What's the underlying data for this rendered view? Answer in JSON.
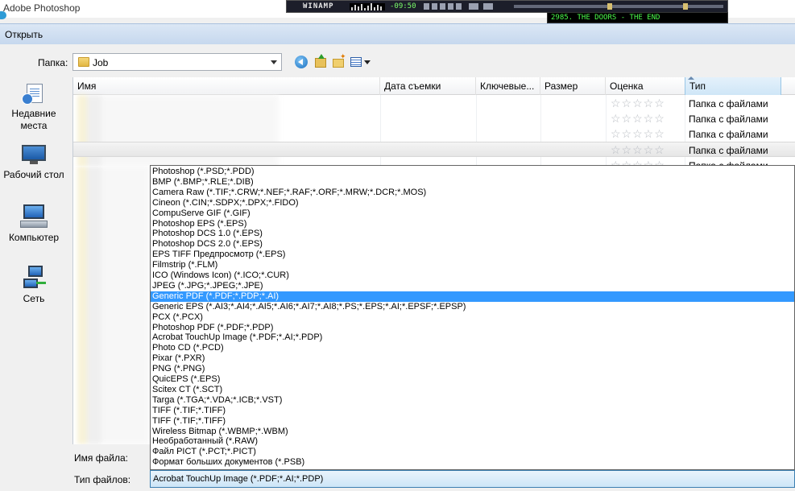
{
  "app": {
    "title": "Adobe Photoshop"
  },
  "winamp": {
    "logo": "WINAMP",
    "time": "-09:50",
    "track": "2985. THE DOORS - THE END"
  },
  "dialog": {
    "title": "Открыть"
  },
  "toolbar": {
    "folder_label": "Папка:",
    "folder_value": "Job",
    "icons": [
      "back-icon",
      "up-folder-icon",
      "new-folder-icon",
      "views-menu-icon"
    ]
  },
  "places": [
    {
      "label": "Недавние места",
      "icon": "recent-places-icon"
    },
    {
      "label": "Рабочий стол",
      "icon": "desktop-icon"
    },
    {
      "label": "Компьютер",
      "icon": "computer-icon"
    },
    {
      "label": "Сеть",
      "icon": "network-icon"
    }
  ],
  "columns": [
    "Имя",
    "Дата съемки",
    "Ключевые...",
    "Размер",
    "Оценка",
    "Тип"
  ],
  "rows": [
    {
      "type": "Папка с файлами",
      "rating": "☆☆☆☆☆"
    },
    {
      "type": "Папка с файлами",
      "rating": "☆☆☆☆☆"
    },
    {
      "type": "Папка с файлами",
      "rating": "☆☆☆☆☆"
    },
    {
      "type": "Папка с файлами",
      "rating": "☆☆☆☆☆"
    },
    {
      "type": "Папка с файлами",
      "rating": "☆☆☆☆☆"
    }
  ],
  "file_types": [
    "Photoshop (*.PSD;*.PDD)",
    "BMP (*.BMP;*.RLE;*.DIB)",
    "Camera Raw (*.TIF;*.CRW;*.NEF;*.RAF;*.ORF;*.MRW;*.DCR;*.MOS)",
    "Cineon (*.CIN;*.SDPX;*.DPX;*.FIDO)",
    "CompuServe GIF (*.GIF)",
    "Photoshop EPS (*.EPS)",
    "Photoshop DCS 1.0 (*.EPS)",
    "Photoshop DCS 2.0 (*.EPS)",
    "EPS TIFF Предпросмотр (*.EPS)",
    "Filmstrip (*.FLM)",
    "ICO (Windows Icon) (*.ICO;*.CUR)",
    "JPEG (*.JPG;*.JPEG;*.JPE)",
    "Generic PDF (*.PDF;*.PDP;*.AI)",
    "Generic EPS (*.AI3;*.AI4;*.AI5;*.AI6;*.AI7;*.AI8;*.PS;*.EPS;*.AI;*.EPSF;*.EPSP)",
    "PCX (*.PCX)",
    "Photoshop PDF (*.PDF;*.PDP)",
    "Acrobat TouchUp Image (*.PDF;*.AI;*.PDP)",
    "Photo CD (*.PCD)",
    "Pixar (*.PXR)",
    "PNG (*.PNG)",
    "QuicEPS (*.EPS)",
    "Scitex CT (*.SCT)",
    "Targa (*.TGA;*.VDA;*.ICB;*.VST)",
    "TIFF (*.TIF;*.TIFF)",
    "TIFF (*.TIF;*.TIFF)",
    "Wireless Bitmap (*.WBMP;*.WBM)",
    "Необработанный (*.RAW)",
    "Файл PICT (*.PCT;*.PICT)",
    "Формат больших документов (*.PSB)"
  ],
  "selected_file_type_index": 12,
  "bottom": {
    "filename_label": "Имя файла:",
    "filetype_label": "Тип файлов:",
    "filetype_value": "Acrobat TouchUp Image (*.PDF;*.AI;*.PDP)"
  },
  "colors": {
    "selection": "#3399ff",
    "title_bar": "#c6d8ee",
    "accent": "#2e9bd6"
  }
}
